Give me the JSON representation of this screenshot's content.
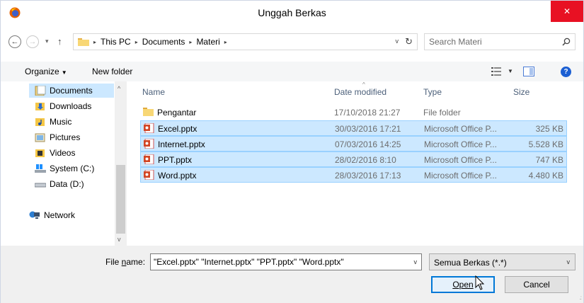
{
  "window": {
    "title": "Unggah Berkas",
    "close_glyph": "✕",
    "icon": "firefox-icon"
  },
  "address_bar": {
    "back_glyph": "←",
    "forward_glyph": "→",
    "recent_glyph": "▾",
    "up_glyph": "↑",
    "breadcrumbs": [
      "This PC",
      "Documents",
      "Materi"
    ],
    "sep_glyph": "▸",
    "dropdown_glyph": "v",
    "refresh_glyph": "↻"
  },
  "search": {
    "placeholder": "Search Materi"
  },
  "toolbar": {
    "organize_label": "Organize",
    "organize_caret": "▼",
    "new_folder_label": "New folder",
    "view_caret": "▼",
    "help_glyph": "?"
  },
  "nav_pane": {
    "items": [
      {
        "label": "Documents",
        "icon": "documents-folder-icon",
        "selected": true
      },
      {
        "label": "Downloads",
        "icon": "downloads-folder-icon"
      },
      {
        "label": "Music",
        "icon": "music-folder-icon"
      },
      {
        "label": "Pictures",
        "icon": "pictures-folder-icon"
      },
      {
        "label": "Videos",
        "icon": "videos-folder-icon"
      },
      {
        "label": "System (C:)",
        "icon": "system-drive-icon"
      },
      {
        "label": "Data (D:)",
        "icon": "data-drive-icon"
      },
      {
        "label": "Network",
        "icon": "network-icon"
      }
    ],
    "scroll_up_glyph": "^",
    "scroll_down_glyph": "v"
  },
  "file_list": {
    "columns": {
      "name": "Name",
      "date": "Date modified",
      "type": "Type",
      "size": "Size"
    },
    "sort_glyph": "^",
    "files": [
      {
        "name": "Pengantar",
        "date": "17/10/2018 21:27",
        "type": "File folder",
        "size": "",
        "icon": "folder-icon",
        "selected": false
      },
      {
        "name": "Excel.pptx",
        "date": "30/03/2016 17:21",
        "type": "Microsoft Office P...",
        "size": "325 KB",
        "icon": "powerpoint-file-icon",
        "selected": true
      },
      {
        "name": "Internet.pptx",
        "date": "07/03/2016 14:25",
        "type": "Microsoft Office P...",
        "size": "5.528 KB",
        "icon": "powerpoint-file-icon",
        "selected": true
      },
      {
        "name": "PPT.pptx",
        "date": "28/02/2016 8:10",
        "type": "Microsoft Office P...",
        "size": "747 KB",
        "icon": "powerpoint-file-icon",
        "selected": true
      },
      {
        "name": "Word.pptx",
        "date": "28/03/2016 17:13",
        "type": "Microsoft Office P...",
        "size": "4.480 KB",
        "icon": "powerpoint-file-icon",
        "selected": true
      }
    ]
  },
  "bottom": {
    "file_name_label_pre": "File ",
    "file_name_label_u": "n",
    "file_name_label_post": "ame:",
    "file_name_value": "\"Excel.pptx\" \"Internet.pptx\" \"PPT.pptx\" \"Word.pptx\"",
    "file_name_dropdown": "v",
    "file_type_value": "Semua Berkas (*.*)",
    "file_type_dropdown": "v",
    "open_label": "Open",
    "cancel_label": "Cancel",
    "grip_glyph": ".:"
  },
  "colors": {
    "selection": "#cce8ff",
    "selection_border": "#99d1ff",
    "close_red": "#e81123",
    "accent_blue": "#0078d7",
    "header_text": "#4c607a"
  }
}
